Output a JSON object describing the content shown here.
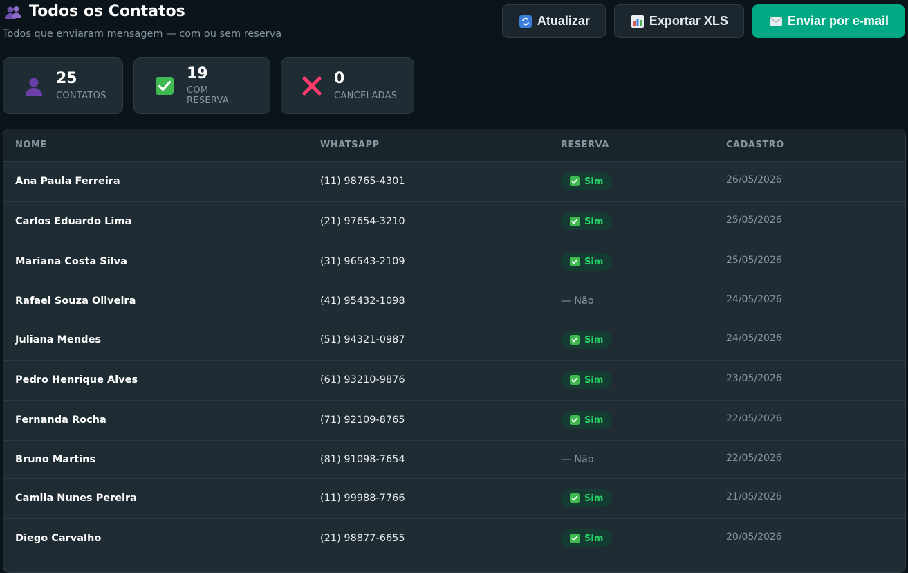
{
  "header": {
    "title": "Todos os Contatos",
    "title_icon": "people-icon",
    "subtitle": "Todos que enviaram mensagem — com ou sem reserva"
  },
  "actions": {
    "refresh_label": "Atualizar",
    "export_label": "Exportar XLS",
    "email_label": "Enviar por e-mail"
  },
  "stats": [
    {
      "value": "25",
      "label": "CONTATOS",
      "icon": "person-icon"
    },
    {
      "value": "19",
      "label": "COM RESERVA",
      "icon": "check-icon"
    },
    {
      "value": "0",
      "label": "CANCELADAS",
      "icon": "cross-icon"
    }
  ],
  "table": {
    "columns": [
      "NOME",
      "WHATSAPP",
      "RESERVA",
      "CADASTRO"
    ],
    "rows": [
      {
        "name": "Ana Paula Ferreira",
        "phone": "(11) 98765-4301",
        "reserva": "Sim",
        "date": "26/05/2026"
      },
      {
        "name": "Carlos Eduardo Lima",
        "phone": "(21) 97654-3210",
        "reserva": "Sim",
        "date": "25/05/2026"
      },
      {
        "name": "Mariana Costa Silva",
        "phone": "(31) 96543-2109",
        "reserva": "Sim",
        "date": "25/05/2026"
      },
      {
        "name": "Rafael Souza Oliveira",
        "phone": "(41) 95432-1098",
        "reserva": "— Não",
        "date": "24/05/2026"
      },
      {
        "name": "Juliana Mendes",
        "phone": "(51) 94321-0987",
        "reserva": "Sim",
        "date": "24/05/2026"
      },
      {
        "name": "Pedro Henrique Alves",
        "phone": "(61) 93210-9876",
        "reserva": "Sim",
        "date": "23/05/2026"
      },
      {
        "name": "Fernanda Rocha",
        "phone": "(71) 92109-8765",
        "reserva": "Sim",
        "date": "22/05/2026"
      },
      {
        "name": "Bruno Martins",
        "phone": "(81) 91098-7654",
        "reserva": "— Não",
        "date": "22/05/2026"
      },
      {
        "name": "Camila Nunes Pereira",
        "phone": "(11) 99988-7766",
        "reserva": "Sim",
        "date": "21/05/2026"
      },
      {
        "name": "Diego Carvalho",
        "phone": "(21) 98877-6655",
        "reserva": "Sim",
        "date": "20/05/2026"
      }
    ]
  },
  "colors": {
    "background": "#0b141b",
    "surface": "#1f2c33",
    "accent": "#00a884",
    "success": "#25d366",
    "danger": "#ff3b6b"
  }
}
